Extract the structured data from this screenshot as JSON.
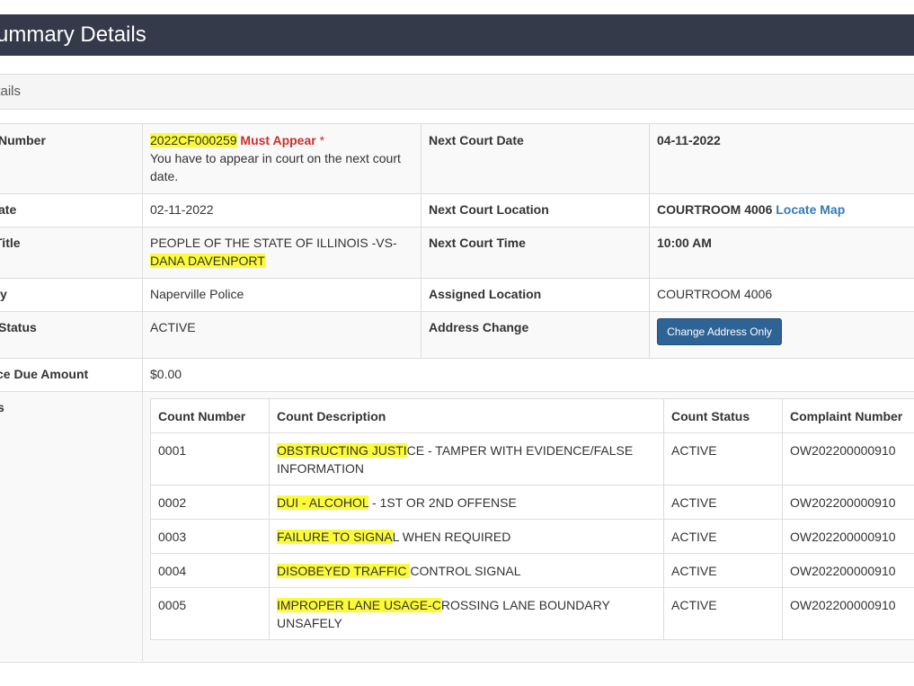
{
  "header": {
    "title": "e Summary Details"
  },
  "panel": {
    "heading": "etails"
  },
  "rows": {
    "case_number": {
      "label": "Number",
      "value": "2022CF000259",
      "flag": "Must Appear",
      "asterisk": " *",
      "note": "You have to appear in court on the next court date."
    },
    "next_court_date": {
      "label": "Next Court Date",
      "value": "04-11-2022"
    },
    "date": {
      "label": "ate",
      "value": "02-11-2022"
    },
    "next_court_location": {
      "label": "Next Court Location",
      "value": "COURTROOM 4006",
      "link": "Locate Map"
    },
    "title": {
      "label": "Title",
      "value_part1": "PEOPLE OF THE STATE OF ILLINOIS -VS-",
      "value_part2": "DANA DAVENPORT"
    },
    "next_court_time": {
      "label": "Next Court Time",
      "value": "10:00 AM"
    },
    "agency": {
      "label": "y",
      "value": "Naperville Police"
    },
    "assigned_location": {
      "label": "Assigned Location",
      "value": "COURTROOM 4006"
    },
    "status": {
      "label": "Status",
      "value": "ACTIVE"
    },
    "address_change": {
      "label": "Address Change",
      "button": "Change Address Only"
    },
    "balance_due": {
      "label": "ce Due Amount",
      "value": "$0.00"
    },
    "counts": {
      "label": "s"
    }
  },
  "counts_table": {
    "headers": [
      "Count Number",
      "Count Description",
      "Count Status",
      "Complaint Number"
    ],
    "rows": [
      {
        "number": "0001",
        "desc_highlight": "OBSTRUCTING JUSTI",
        "desc_rest": "CE - TAMPER WITH EVIDENCE/FALSE INFORMATION",
        "status": "ACTIVE",
        "complaint": "OW202200000910"
      },
      {
        "number": "0002",
        "desc_highlight": "DUI - ALCOHOL",
        "desc_rest": " - 1ST OR 2ND OFFENSE",
        "status": "ACTIVE",
        "complaint": "OW202200000910"
      },
      {
        "number": "0003",
        "desc_highlight": "FAILURE TO SIGNA",
        "desc_rest": "L WHEN REQUIRED",
        "status": "ACTIVE",
        "complaint": "OW202200000910"
      },
      {
        "number": "0004",
        "desc_highlight": "DISOBEYED TRAFFIC ",
        "desc_rest": "CONTROL SIGNAL",
        "status": "ACTIVE",
        "complaint": "OW202200000910"
      },
      {
        "number": "0005",
        "desc_highlight": "IMPROPER LANE USAGE-C",
        "desc_rest": "ROSSING LANE BOUNDARY UNSAFELY",
        "status": "ACTIVE",
        "complaint": "OW202200000910"
      }
    ]
  },
  "colors": {
    "header_bg": "#343a4a",
    "highlight": "#fbfb3a",
    "must_appear": "#c9302c",
    "link": "#337ab7",
    "button": "#2e6395"
  }
}
